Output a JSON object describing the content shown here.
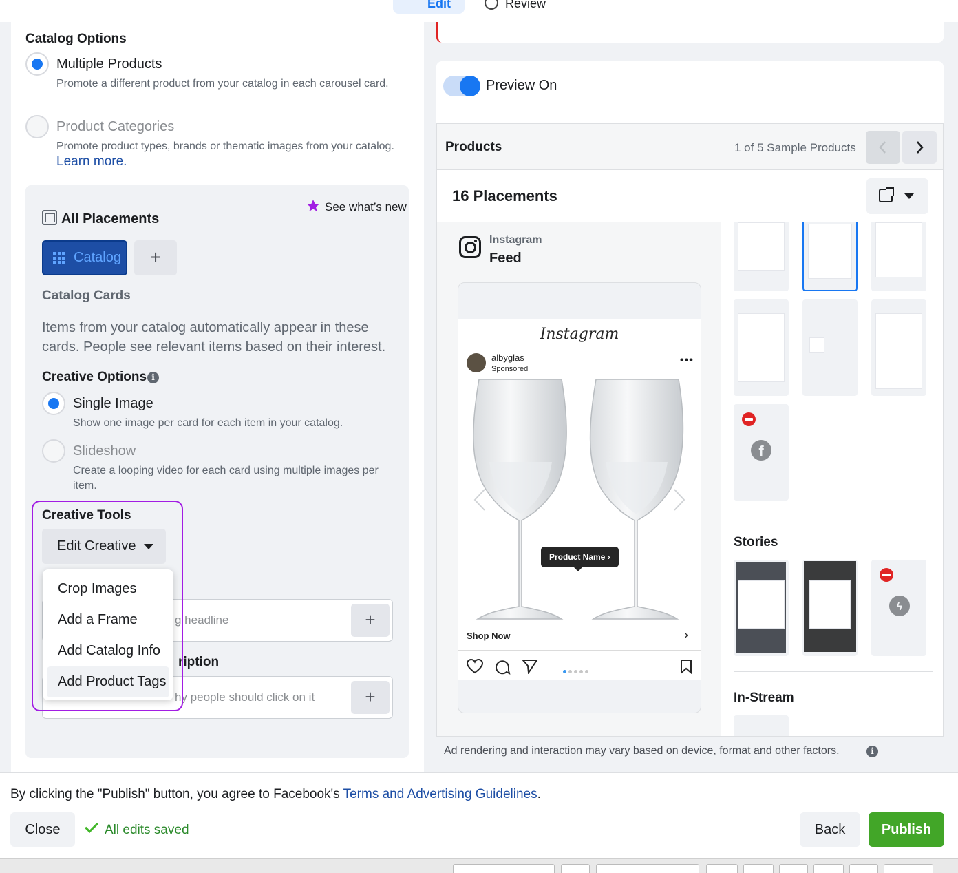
{
  "tabs": {
    "edit": "Edit",
    "review": "Review"
  },
  "catalog_options": {
    "title": "Catalog Options",
    "options": [
      {
        "label": "Multiple Products",
        "desc": "Promote a different product from your catalog in each carousel card.",
        "selected": true
      },
      {
        "label": "Product Categories",
        "desc": "Promote product types, brands or thematic images from your catalog.",
        "link": "Learn more.",
        "selected": false
      }
    ]
  },
  "placements_card": {
    "whats_new": "See what’s new",
    "title": "All Placements",
    "catalog_button": "Catalog",
    "add_button": "+",
    "catalog_cards_title": "Catalog Cards",
    "catalog_cards_desc": "Items from your catalog automatically appear in these cards. People see relevant items based on their interest."
  },
  "creative_options": {
    "title": "Creative Options",
    "info": "i",
    "options": [
      {
        "label": "Single Image",
        "desc": "Show one image per card for each item in your catalog.",
        "selected": true
      },
      {
        "label": "Slideshow",
        "desc": "Create a looping video for each card using multiple images per item.",
        "selected": false
      }
    ]
  },
  "creative_tools": {
    "title": "Creative Tools",
    "button": "Edit Creative",
    "menu": [
      "Crop Images",
      "Add a Frame",
      "Add Catalog Info",
      "Add Product Tags"
    ],
    "active_item": "Add Product Tags"
  },
  "fields": {
    "headline_placeholder": "g headline",
    "description_heading": "ription",
    "description_placeholder": "hy people should click on it",
    "add": "+"
  },
  "preview": {
    "toggle_label": "Preview On",
    "products_title": "Products",
    "sample_count": "1 of 5 Sample Products",
    "placements_title": "16 Placements",
    "platform": "Instagram",
    "position": "Feed",
    "ig_logo": "Instagram",
    "account": "albyglas",
    "sponsored": "Sponsored",
    "more": "•••",
    "product_tag": "Product Name",
    "cta": "Shop Now",
    "stories_title": "Stories",
    "instream_title": "In-Stream",
    "disclaimer": "Ad rendering and interaction may vary based on device, format and other factors."
  },
  "footer": {
    "agree_prefix": "By clicking the \"Publish\" button, you agree to Facebook's ",
    "agree_link": "Terms and Advertising Guidelines",
    "agree_suffix": ".",
    "close": "Close",
    "saved": "All edits saved",
    "back": "Back",
    "publish": "Publish"
  },
  "colors": {
    "accent": "#1877f2",
    "catalog_button": "#1d4ea5",
    "highlight": "#a21de3",
    "publish": "#42a628",
    "error": "#e02424"
  }
}
